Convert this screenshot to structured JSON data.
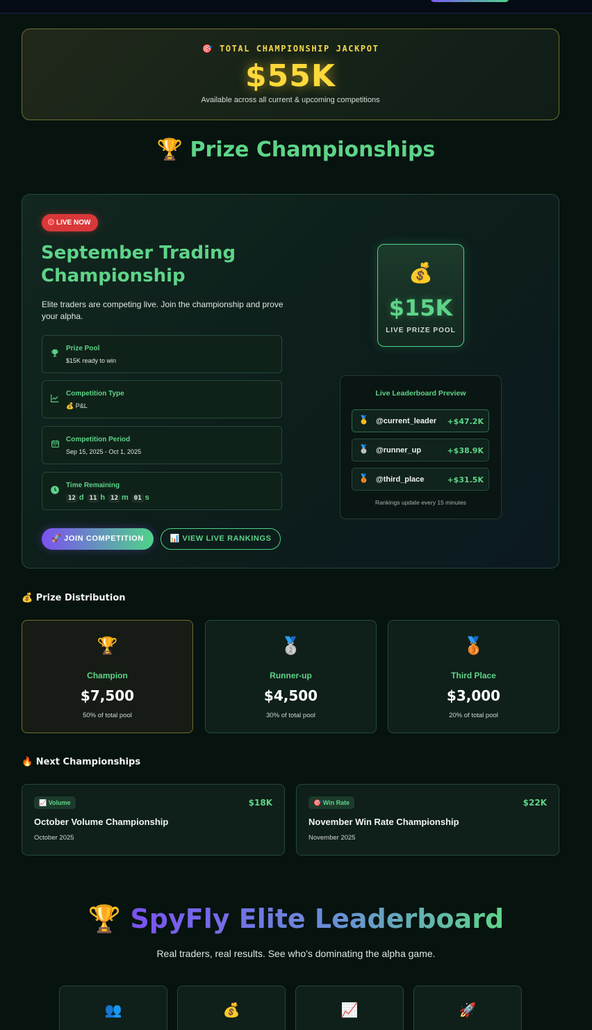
{
  "jackpot": {
    "icon": "🎯",
    "label": "TOTAL CHAMPIONSHIP JACKPOT",
    "amount": "$55K",
    "subtitle": "Available across all current & upcoming competitions"
  },
  "prize_section": {
    "icon": "🏆",
    "title": "Prize Championships"
  },
  "live": {
    "badge": "LIVE NOW",
    "title": "September Trading Championship",
    "description": "Elite traders are competing live. Join the championship and prove your alpha.",
    "info": [
      {
        "icon": "trophy-icon",
        "label": "Prize Pool",
        "value": "$15K ready to win"
      },
      {
        "icon": "chart-line-icon",
        "label": "Competition Type",
        "value": "💰 P&L"
      },
      {
        "icon": "calendar-icon",
        "label": "Competition Period",
        "value": "Sep 15, 2025 - Oct 1, 2025"
      },
      {
        "icon": "clock-icon",
        "label": "Time Remaining"
      }
    ],
    "timer": {
      "days": "12",
      "days_unit": "d",
      "hours": "11",
      "hours_unit": "h",
      "minutes": "12",
      "minutes_unit": "m",
      "seconds": "01",
      "seconds_unit": "s"
    },
    "join_label": "🚀 JOIN COMPETITION",
    "view_label": "📊 VIEW LIVE RANKINGS",
    "pool": {
      "icon": "💰",
      "amount": "$15K",
      "label": "LIVE PRIZE POOL"
    },
    "leaderboard": {
      "heading": "Live Leaderboard Preview",
      "rows": [
        {
          "medal": "🥇",
          "handle": "@current_leader",
          "pnl": "+$47.2K"
        },
        {
          "medal": "🥈",
          "handle": "@runner_up",
          "pnl": "+$38.9K"
        },
        {
          "medal": "🥉",
          "handle": "@third_place",
          "pnl": "+$31.5K"
        }
      ],
      "footer": "Rankings update every 15 minutes"
    }
  },
  "distribution": {
    "title": "💰 Prize Distribution",
    "cards": [
      {
        "medal": "🏆",
        "place": "Champion",
        "amount": "$7,500",
        "share": "50% of total pool"
      },
      {
        "medal": "🥈",
        "place": "Runner-up",
        "amount": "$4,500",
        "share": "30% of total pool"
      },
      {
        "medal": "🥉",
        "place": "Third Place",
        "amount": "$3,000",
        "share": "20% of total pool"
      }
    ]
  },
  "next": {
    "title": "🔥 Next Championships",
    "cards": [
      {
        "tag": "📈 Volume",
        "pool": "$18K",
        "name": "October Volume Championship",
        "date": "October 2025"
      },
      {
        "tag": "🎯 Win Rate",
        "pool": "$22K",
        "name": "November Win Rate Championship",
        "date": "November 2025"
      }
    ]
  },
  "elite": {
    "icon": "🏆",
    "title": "SpyFly Elite Leaderboard",
    "subtitle": "Real traders, real results. See who's dominating the alpha game.",
    "stat_icons": [
      "👥",
      "💰",
      "📈",
      "🚀"
    ]
  },
  "colors": {
    "accent_green": "#5ed488",
    "accent_purple": "#7b52f0",
    "gold": "#ffd93a",
    "live_red": "#d9383a",
    "background": "#07130f"
  }
}
